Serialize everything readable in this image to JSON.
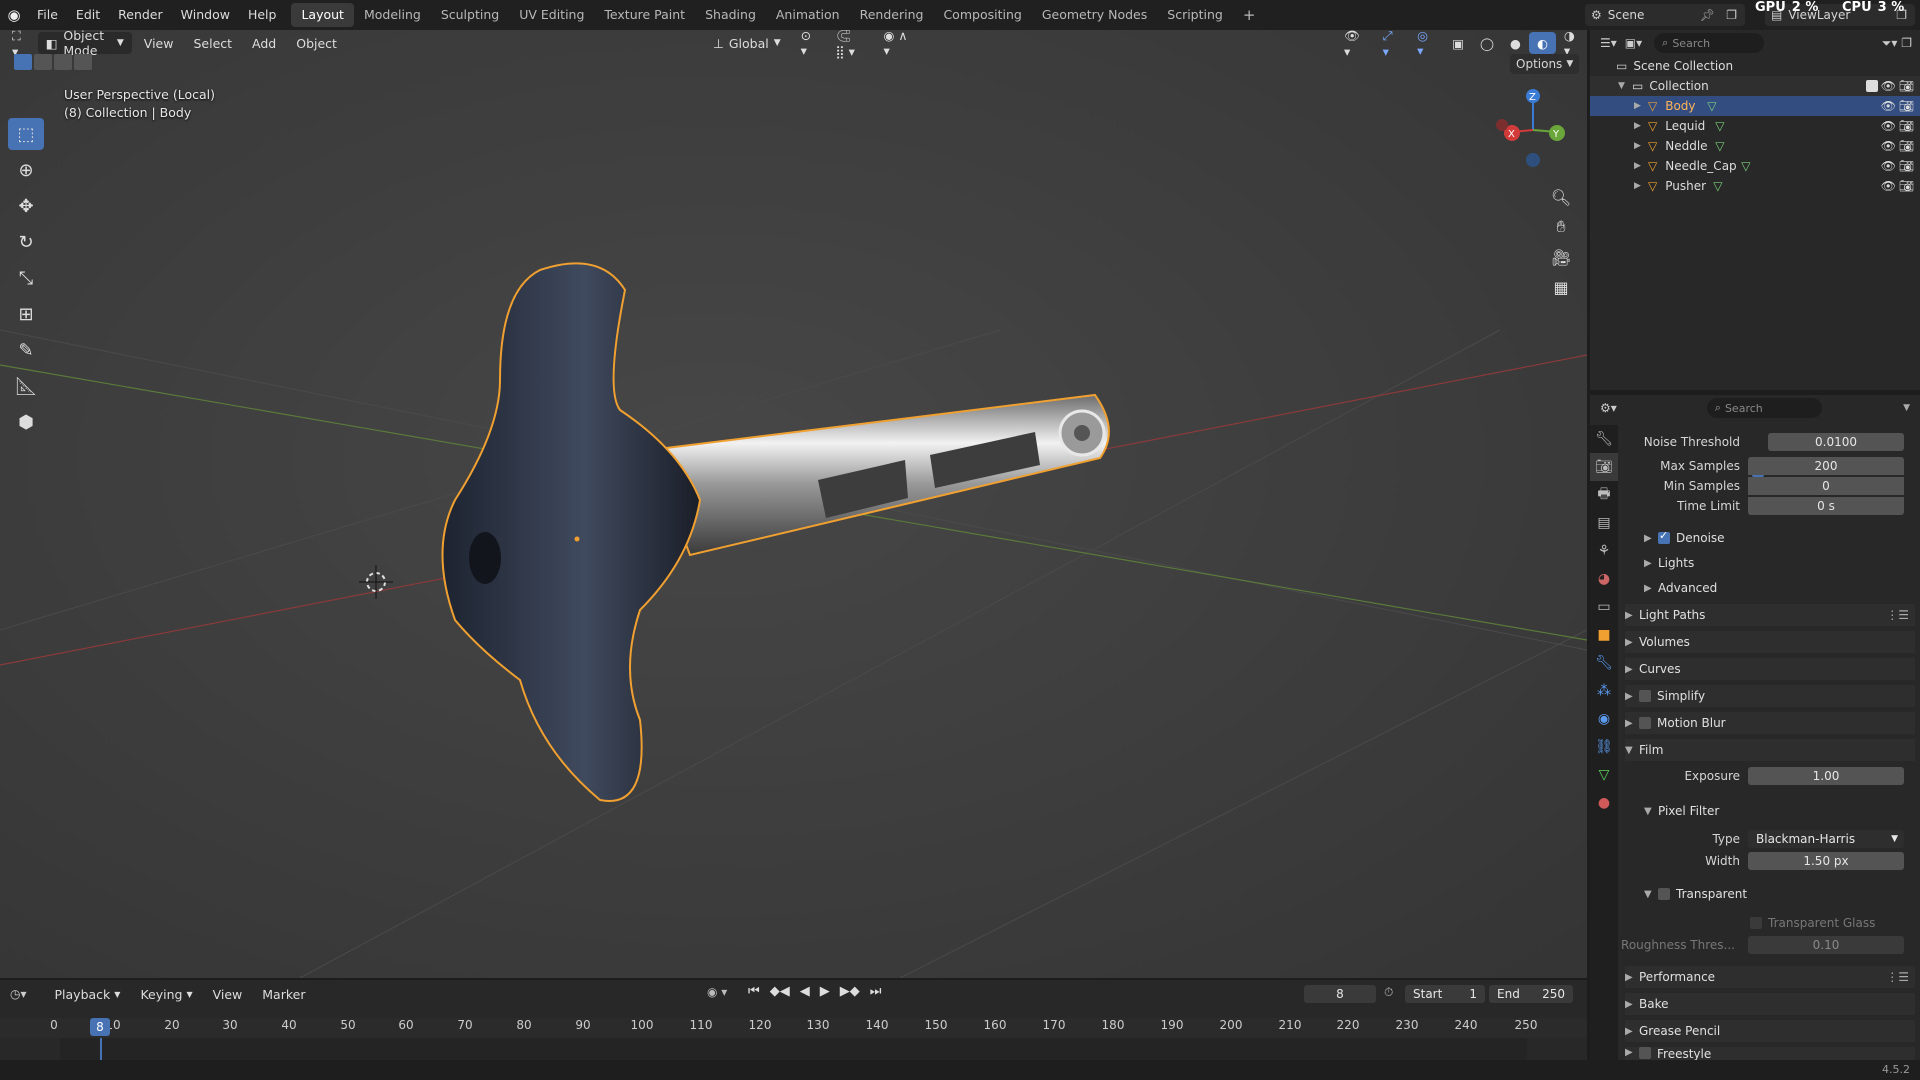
{
  "topbar": {
    "menus": [
      "File",
      "Edit",
      "Render",
      "Window",
      "Help"
    ],
    "workspaces": [
      "Layout",
      "Modeling",
      "Sculpting",
      "UV Editing",
      "Texture Paint",
      "Shading",
      "Animation",
      "Rendering",
      "Compositing",
      "Geometry Nodes",
      "Scripting"
    ],
    "active_workspace": "Layout",
    "add_label": "+",
    "scene": "Scene",
    "view_layer": "ViewLayer",
    "gpu_label": "GPU",
    "gpu_value": "2 %",
    "cpu_label": "CPU",
    "cpu_value": "3 %"
  },
  "viewport": {
    "mode": "Object Mode",
    "menu": [
      "View",
      "Select",
      "Add",
      "Object"
    ],
    "orientation": "Global",
    "options_label": "Options",
    "overlay_title": "User Perspective (Local)",
    "overlay_subtitle": "(8) Collection | Body",
    "gizmo_axes": [
      "X",
      "Y",
      "Z"
    ]
  },
  "outliner": {
    "search_placeholder": "Search",
    "root": "Scene Collection",
    "collection": "Collection",
    "objects": [
      {
        "name": "Body",
        "selected": true
      },
      {
        "name": "Lequid",
        "selected": false
      },
      {
        "name": "Neddle",
        "selected": false
      },
      {
        "name": "Needle_Cap",
        "selected": false
      },
      {
        "name": "Pusher",
        "selected": false
      }
    ]
  },
  "properties": {
    "search_placeholder": "Search",
    "noise_threshold_label": "Noise Threshold",
    "noise_threshold": "0.0100",
    "max_samples_label": "Max Samples",
    "max_samples": "200",
    "min_samples_label": "Min Samples",
    "min_samples": "0",
    "time_limit_label": "Time Limit",
    "time_limit": "0 s",
    "denoise": "Denoise",
    "lights": "Lights",
    "advanced": "Advanced",
    "light_paths": "Light Paths",
    "volumes": "Volumes",
    "curves": "Curves",
    "simplify": "Simplify",
    "motion_blur": "Motion Blur",
    "film": "Film",
    "exposure_label": "Exposure",
    "exposure": "1.00",
    "pixel_filter": "Pixel Filter",
    "type_label": "Type",
    "type_value": "Blackman-Harris",
    "width_label": "Width",
    "width_value": "1.50 px",
    "transparent": "Transparent",
    "transparent_glass": "Transparent Glass",
    "roughness_label": "Roughness Thres...",
    "roughness_value": "0.10",
    "performance": "Performance",
    "bake": "Bake",
    "grease_pencil": "Grease Pencil",
    "freestyle": "Freestyle"
  },
  "timeline": {
    "menus": [
      "Playback",
      "Keying",
      "View",
      "Marker"
    ],
    "current_frame": "8",
    "start_label": "Start",
    "start": "1",
    "end_label": "End",
    "end": "250",
    "ticks": [
      "0",
      "10",
      "20",
      "30",
      "40",
      "50",
      "60",
      "70",
      "80",
      "90",
      "100",
      "110",
      "120",
      "130",
      "140",
      "150",
      "160",
      "170",
      "180",
      "190",
      "200",
      "210",
      "220",
      "230",
      "240",
      "250"
    ]
  },
  "status": {
    "version": "4.5.2"
  },
  "colors": {
    "accent": "#4772b3",
    "selection_outline": "#f0a030",
    "viewport_bg": "#3d3d3d"
  }
}
